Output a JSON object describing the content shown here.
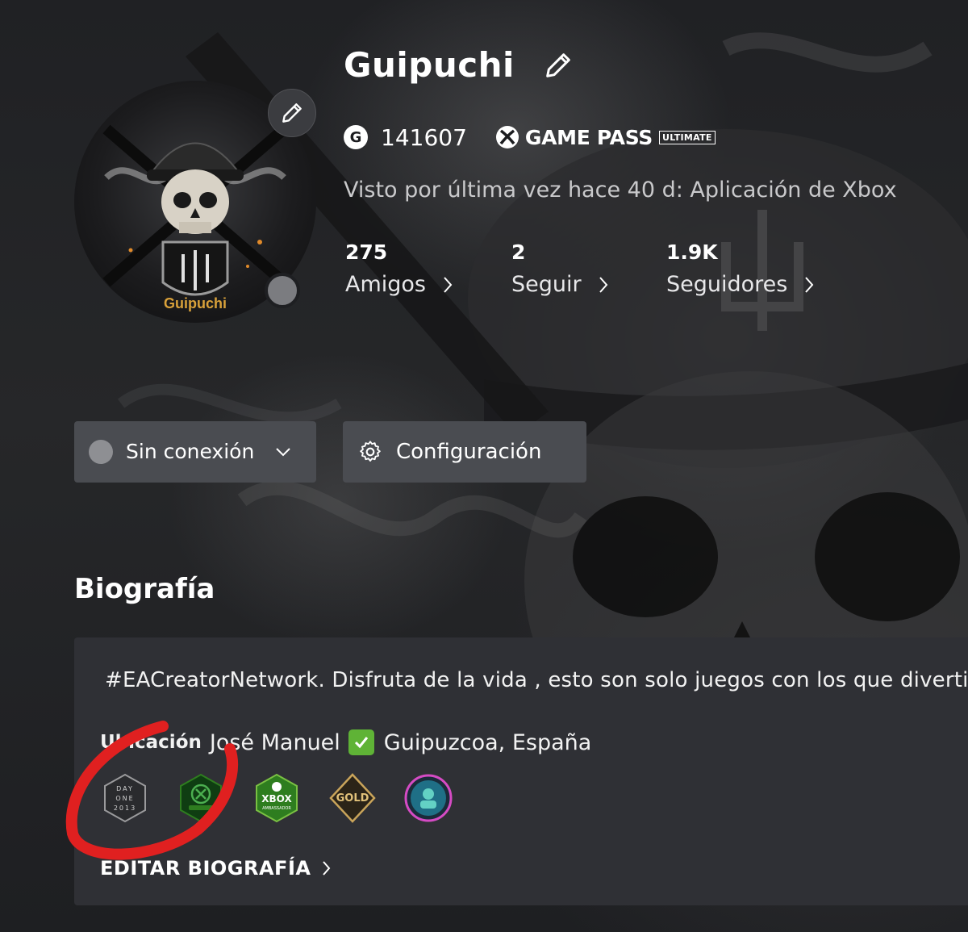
{
  "profile": {
    "gamertag": "Guipuchi",
    "avatar_name": "Guipuchi",
    "gamerscore_badge": "G",
    "gamerscore": "141607",
    "gamepass_label": "GAME PASS",
    "gamepass_tier": "ULTIMATE",
    "last_seen": "Visto por última vez hace 40 d: Aplicación de Xbox"
  },
  "stats": [
    {
      "value": "275",
      "label": "Amigos"
    },
    {
      "value": "2",
      "label": "Seguir"
    },
    {
      "value": "1.9K",
      "label": "Seguidores"
    }
  ],
  "actions": {
    "status_label": "Sin conexión",
    "config_label": "Configuración"
  },
  "bio": {
    "heading": "Biografía",
    "text": "#EACreatorNetwork.  Disfruta de la vida , esto son solo juegos con los que divertirse",
    "location_label": "Ubicación",
    "location_value_a": "José Manuel",
    "location_value_b": "Guipuzcoa, España",
    "edit_label": "EDITAR BIOGRAFÍA"
  },
  "badges": [
    {
      "name": "day-one-2013-badge",
      "lines": [
        "DAY",
        "ONE",
        "2013"
      ],
      "color": "#2a2b2e"
    },
    {
      "name": "xbox-green-badge",
      "text": "",
      "color": "#0f3d12"
    },
    {
      "name": "xbox-ambassador-badge",
      "lines": [
        "XBOX",
        "AMBASSADOR"
      ],
      "color": "#2e7d1f"
    },
    {
      "name": "gold-badge",
      "lines": [
        "GOLD"
      ],
      "color": "#8a6a2a"
    },
    {
      "name": "weekly-set-streak-badge",
      "text": "",
      "color": "#1f6f86"
    }
  ],
  "colors": {
    "accent_green": "#107c10",
    "panel": "#2f3035",
    "button": "#4a4c51",
    "annotation_red": "#e02020"
  }
}
